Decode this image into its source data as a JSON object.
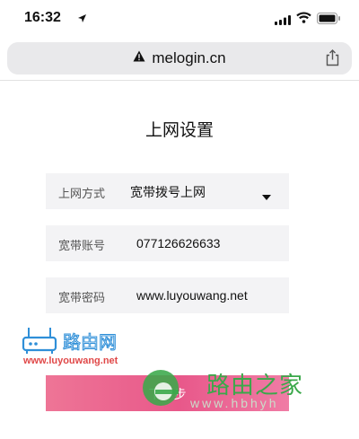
{
  "status_bar": {
    "time": "16:32",
    "icons": [
      "location-arrow-icon",
      "signal-icon",
      "wifi-icon",
      "battery-icon"
    ]
  },
  "browser": {
    "url": "melogin.cn",
    "icons": [
      "warning-icon",
      "share-icon"
    ]
  },
  "page": {
    "title": "上网设置",
    "fields": {
      "mode": {
        "label": "上网方式",
        "value": "宽带拨号上网"
      },
      "account": {
        "label": "宽带账号",
        "value": "077126626633"
      },
      "password": {
        "label": "宽带密码",
        "value": "www.luyouwang.net"
      }
    },
    "submit_label": "下一步"
  },
  "watermarks": {
    "luyou_name": "路由网",
    "luyou_url": "www.luyouwang.net",
    "home_name": "路由之家",
    "home_url": "www.hbhyh"
  },
  "colors": {
    "button_gradient_start": "#ee7596",
    "button_gradient_end": "#f07ca5",
    "field_background": "#f3f3f5",
    "watermark_green": "#3aa84a",
    "watermark_blue": "#2f8fd8",
    "watermark_red": "#e04848"
  }
}
